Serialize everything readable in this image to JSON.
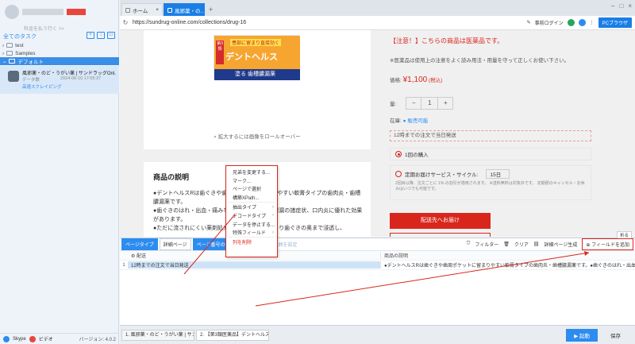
{
  "left": {
    "subtitle": "料金を払う行く >>",
    "section": "全てのタスク",
    "tree": [
      {
        "label": "test"
      },
      {
        "label": "Samples"
      },
      {
        "label": "デフォルト"
      }
    ],
    "task": {
      "title": "風邪薬・のど・うがい薬 | サンドラッグOnl...",
      "line2a": "データ数",
      "line2b": "2024-06-10 17:05:37",
      "line3": "高速スクレイピング"
    },
    "footer": {
      "skype": "Skype",
      "video": "ビデオ",
      "version": "バージョン: 4.0.2"
    }
  },
  "browser": {
    "tabs": [
      {
        "label": "ホーム"
      },
      {
        "label": "風邪薬・の..."
      }
    ],
    "url": "https://sundrug-online.com/collections/drug-16",
    "login": "事前ログイン",
    "pc_browser": "PCブラウザ"
  },
  "page": {
    "product": {
      "tag": "患部に留まり直接効く",
      "side": "第3類",
      "brand": "デントヘルス",
      "bottom": "塗る 歯槽膿漏薬"
    },
    "zoom_hint": "拡大するには画像をロールオーバー",
    "desc_title": "商品の説明",
    "desc_lines": [
      "●デントヘルスRは歯ぐきや歯周ポケットに留まりやすい軟膏タイプの歯肉炎・歯槽膿漏薬です。",
      "●歯ぐきのはれ・出血・痛みなどの歯肉炎・歯槽膿漏の諸症状、口内炎に優れた効果があります。",
      "●ただに流されにくい薬剤処方でゆっくり長く留まり歯ぐきの奥まで浸透し、"
    ],
    "notice": "【注意！】こちらの商品は医薬品です。",
    "notice2": "※医薬品は使用上の注意をよく読み用法・用量を守って正しくお使い下さい。",
    "price_label": "価格:",
    "price": "¥1,100",
    "price_tax": "(税込)",
    "qty_label": "量:",
    "qty_minus": "−",
    "qty_value": "1",
    "qty_plus": "+",
    "stock_label": "在庫:",
    "stock_value": "販売可能",
    "ship": "12時までの注文で当日発送",
    "opt1": "1回の購入",
    "opt2": "定期お届けサービス・サイクル:",
    "opt2_select": "15日",
    "opt2_small": "2回目以降、注文ごとに 1% の割引が適用されます。 ※送料無料は対象外です。 定期便のキャンセル・お休みはいつでも可能です。",
    "cart": "配送先へお届け"
  },
  "context_menu": [
    {
      "label": "兄弟を変更する...",
      "arrow": false
    },
    {
      "label": "マーク...",
      "arrow": false
    },
    {
      "label": "ページで選択",
      "arrow": false
    },
    {
      "label": "構築XPath...",
      "arrow": false
    },
    {
      "label": "抽出タイプ",
      "arrow": true
    },
    {
      "label": "デコードタイプ",
      "arrow": true
    },
    {
      "label": "データを停止する...",
      "arrow": false
    },
    {
      "label": "特殊フィールド",
      "arrow": true
    },
    {
      "label": "列を削除",
      "arrow": false,
      "red": true
    }
  ],
  "panel": {
    "btn_page_type": "ページタイプ",
    "btn_detail": "詳細ページ",
    "btn_page_setting": "ページ番号の設定",
    "faded": "スクレイピング範囲を設定",
    "filter": "フィルター",
    "clear": "クリア",
    "detail_gen": "詳細ページ生成",
    "add_field": "フィールドを追加",
    "fold": "折る",
    "col1": "配送",
    "col2": "商品の説明",
    "row_idx": "1",
    "row_c1": "12時までの注文で当日発送",
    "row_c2": "●デントヘルスRは歯ぐきや歯周ポケットに留まりやすい軟膏タイプの歯肉炎・歯槽膿漏薬です。●歯ぐきのはれ・出血・痛み、口内炎に..."
  },
  "foot_tabs": [
    {
      "label": "1. 風邪薬・のど・うがい薬 | サン..."
    },
    {
      "label": "2. 【第3類医薬品】デントヘルスR..."
    }
  ],
  "start": "起動",
  "save": "保存",
  "colors": {
    "accent": "#1a7ee6",
    "red": "#d9261c"
  }
}
